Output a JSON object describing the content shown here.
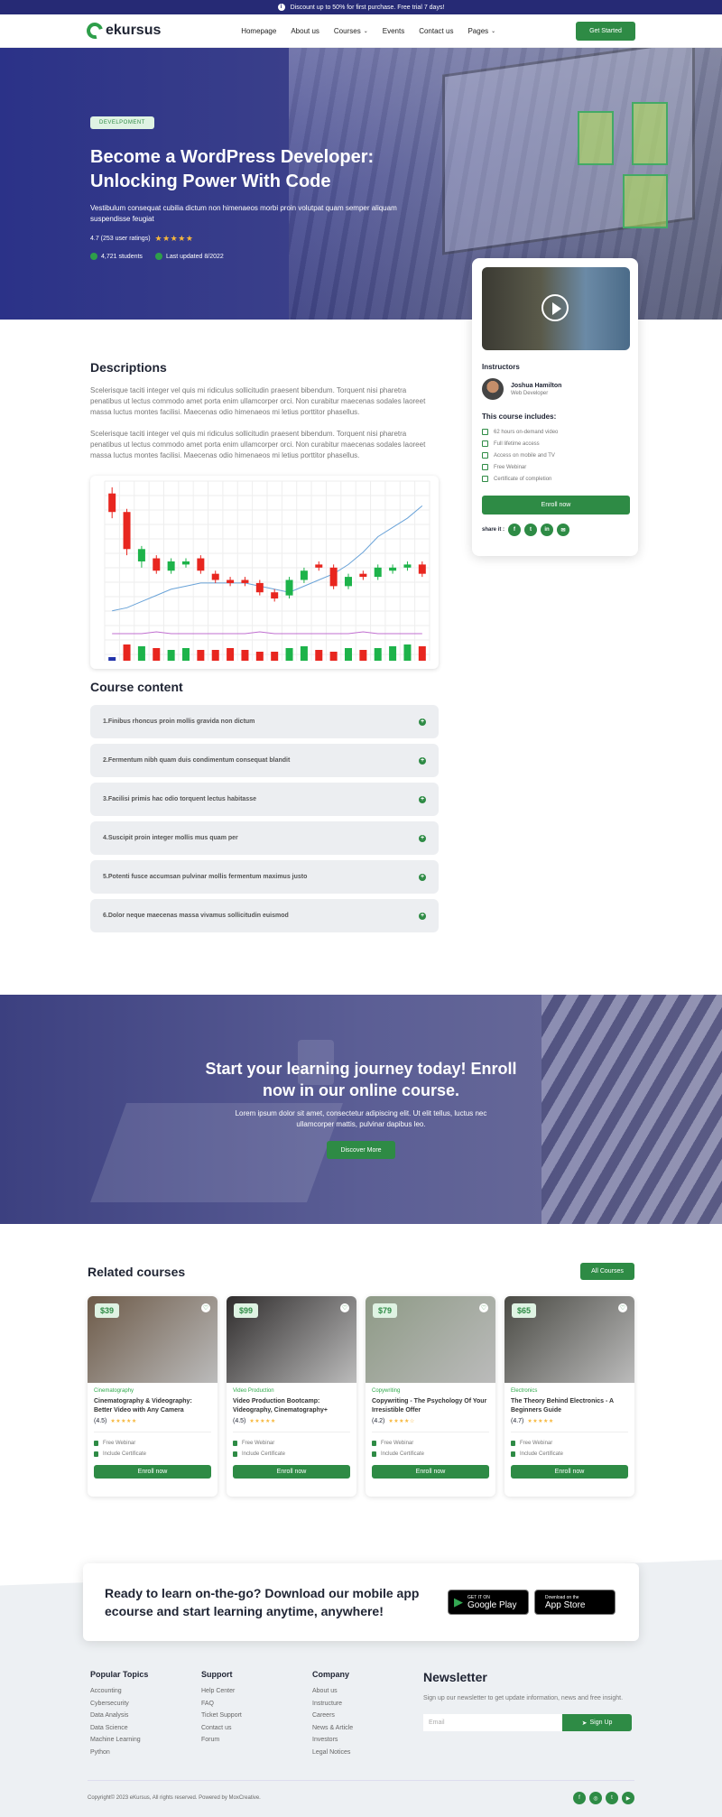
{
  "topbar": {
    "text": "Discount up to 50% for first purchase. Free trial 7 days!"
  },
  "nav": {
    "logo": "ekursus",
    "items": [
      "Homepage",
      "About us",
      "Courses",
      "Events",
      "Contact us",
      "Pages"
    ],
    "cta": "Get Started"
  },
  "hero": {
    "tag": "DEVELPOMENT",
    "title_line1": "Become a WordPress Developer:",
    "title_line2": "Unlocking Power With Code",
    "subtitle": "Vestibulum consequat cubilia dictum non himenaeos morbi proin volutpat quam semper aliquam suspendisse feugiat",
    "rating_text": "4.7 (253 user ratings)",
    "stars": "★★★★★",
    "students": "4,721 students",
    "updated": "Last updated 8/2022"
  },
  "descriptions": {
    "title": "Descriptions",
    "p1": "Scelerisque taciti integer vel quis mi ridiculus sollicitudin praesent bibendum. Torquent nisi pharetra penatibus ut lectus commodo amet porta enim ullamcorper orci. Non curabitur maecenas sodales laoreet massa luctus montes facilisi. Maecenas odio himenaeos mi letius porttitor phasellus.",
    "p2": "Scelerisque taciti integer vel quis mi ridiculus sollicitudin praesent bibendum. Torquent nisi pharetra penatibus ut lectus commodo amet porta enim ullamcorper orci. Non curabitur maecenas sodales laoreet massa luctus montes facilisi. Maecenas odio himenaeos mi letius porttitor phasellus."
  },
  "chart_data": {
    "type": "bar",
    "candles": [
      {
        "o": 66,
        "c": 60,
        "h": 68,
        "l": 58,
        "up": false
      },
      {
        "o": 60,
        "c": 48,
        "h": 61,
        "l": 46,
        "up": false
      },
      {
        "o": 44,
        "c": 48,
        "h": 49,
        "l": 42,
        "up": true
      },
      {
        "o": 45,
        "c": 41,
        "h": 46,
        "l": 40,
        "up": false
      },
      {
        "o": 41,
        "c": 44,
        "h": 45,
        "l": 40,
        "up": true
      },
      {
        "o": 44,
        "c": 43,
        "h": 45,
        "l": 42,
        "up": true
      },
      {
        "o": 45,
        "c": 41,
        "h": 46,
        "l": 40,
        "up": false
      },
      {
        "o": 40,
        "c": 38,
        "h": 41,
        "l": 37,
        "up": false
      },
      {
        "o": 38,
        "c": 37,
        "h": 39,
        "l": 36,
        "up": false
      },
      {
        "o": 38,
        "c": 37,
        "h": 39,
        "l": 36,
        "up": false
      },
      {
        "o": 37,
        "c": 34,
        "h": 38,
        "l": 33,
        "up": false
      },
      {
        "o": 34,
        "c": 32,
        "h": 35,
        "l": 31,
        "up": false
      },
      {
        "o": 33,
        "c": 38,
        "h": 39,
        "l": 32,
        "up": true
      },
      {
        "o": 38,
        "c": 41,
        "h": 42,
        "l": 37,
        "up": true
      },
      {
        "o": 42,
        "c": 43,
        "h": 44,
        "l": 41,
        "up": false
      },
      {
        "o": 42,
        "c": 36,
        "h": 43,
        "l": 35,
        "up": false
      },
      {
        "o": 36,
        "c": 39,
        "h": 40,
        "l": 35,
        "up": true
      },
      {
        "o": 39,
        "c": 40,
        "h": 41,
        "l": 38,
        "up": false
      },
      {
        "o": 39,
        "c": 42,
        "h": 43,
        "l": 38,
        "up": true
      },
      {
        "o": 41,
        "c": 42,
        "h": 43,
        "l": 40,
        "up": true
      },
      {
        "o": 42,
        "c": 43,
        "h": 44,
        "l": 41,
        "up": true
      },
      {
        "o": 43,
        "c": 40,
        "h": 44,
        "l": 39,
        "up": false
      }
    ],
    "line": [
      28,
      29,
      31,
      33,
      35,
      36,
      37,
      37,
      37,
      37,
      36,
      35,
      34,
      36,
      38,
      40,
      43,
      47,
      52,
      55,
      58,
      62
    ],
    "volume": [
      2,
      9,
      8,
      7,
      6,
      7,
      6,
      6,
      7,
      6,
      5,
      5,
      7,
      8,
      6,
      5,
      7,
      6,
      7,
      8,
      9,
      8
    ]
  },
  "course_content": {
    "title": "Course content",
    "items": [
      "1.Finibus rhoncus proin mollis gravida non dictum",
      "2.Fermentum nibh quam duis condimentum consequat blandit",
      "3.Facilisi primis hac odio torquent lectus habitasse",
      "4.Suscipit proin integer mollis mus quam per",
      "5.Potenti fusce accumsan pulvinar mollis fermentum maximus justo",
      "6.Dolor neque maecenas massa vivamus sollicitudin euismod"
    ]
  },
  "sidebar": {
    "instructors_title": "Instructors",
    "instructor_name": "Joshua Hamilton",
    "instructor_role": "Web Developer",
    "includes_title": "This course includes:",
    "includes": [
      "62 hours on-demand video",
      "Full lifetime access",
      "Access on mobile and TV",
      "Free Webinar",
      "Certificate of completion"
    ],
    "enroll": "Enroll now",
    "share_label": "share it :",
    "share_icons": [
      "facebook-icon",
      "twitter-icon",
      "linkedin-icon",
      "email-icon"
    ]
  },
  "cta": {
    "title_line1": "Start your learning journey today! Enroll",
    "title_line2": "now in our online course.",
    "text": "Lorem ipsum dolor sit amet, consectetur adipiscing elit. Ut elit tellus, luctus nec ullamcorper mattis, pulvinar dapibus leo.",
    "button": "Discover More"
  },
  "related": {
    "title": "Related courses",
    "all_button": "All Courses",
    "cards": [
      {
        "price": "$39",
        "category": "Cinematography",
        "title": "Cinematography & Videography: Better Video with Any Camera",
        "rating": "(4.5)",
        "stars": "★★★★★",
        "f1": "Free Webinar",
        "f2": "Include Certificate",
        "button": "Enroll now",
        "img": "#6d5a48"
      },
      {
        "price": "$99",
        "category": "Video Production",
        "title": "Video Production Bootcamp: Videography, Cinematography+",
        "rating": "(4.5)",
        "stars": "★★★★★",
        "f1": "Free Webinar",
        "f2": "Include Certificate",
        "button": "Enroll now",
        "img": "#2f2c2c"
      },
      {
        "price": "$79",
        "category": "Copywriting",
        "title": "Copywriting - The Psychology Of Your Irresistible Offer",
        "rating": "(4.2)",
        "stars": "★★★★☆",
        "f1": "Free Webinar",
        "f2": "Include Certificate",
        "button": "Enroll now",
        "img": "#8e9a86"
      },
      {
        "price": "$65",
        "category": "Electronics",
        "title": "The Theory Behind Electronics - A Beginners Guide",
        "rating": "(4.7)",
        "stars": "★★★★★",
        "f1": "Free Webinar",
        "f2": "Include Certificate",
        "button": "Enroll now",
        "img": "#4a4a44"
      }
    ]
  },
  "app": {
    "title": "Ready to learn on-the-go? Download our mobile app ecourse and start learning anytime, anywhere!",
    "google_small": "GET IT ON",
    "google_big": "Google Play",
    "apple_small": "Download on the",
    "apple_big": "App Store"
  },
  "footer": {
    "col1_title": "Popular Topics",
    "col1": [
      "Accounting",
      "Cybersecurity",
      "Data Analysis",
      "Data Science",
      "Machine Learning",
      "Python"
    ],
    "col2_title": "Support",
    "col2": [
      "Help Center",
      "FAQ",
      "Ticket Support",
      "Contact us",
      "Forum"
    ],
    "col3_title": "Company",
    "col3": [
      "About us",
      "Instructure",
      "Careers",
      "News & Article",
      "Investors",
      "Legal Notices"
    ],
    "news_title": "Newsletter",
    "news_text": "Sign up our newsletter to get update information, news and free insight.",
    "email_placeholder": "Email",
    "signup": "Sign Up",
    "copyright": "Copyright© 2023 eKursus, All rights reserved. Powered by MoxCreative."
  },
  "colors": {
    "primary": "#2e8b45",
    "navy": "#262a75"
  }
}
